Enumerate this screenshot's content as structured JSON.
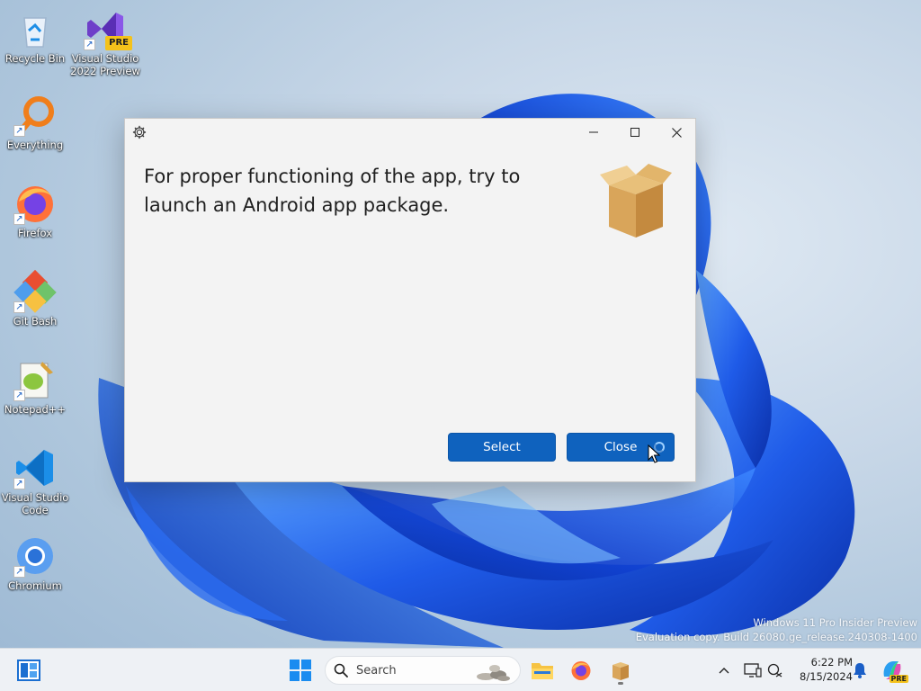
{
  "desktop": {
    "icons": [
      {
        "label": "Recycle Bin",
        "icon": "recycle-bin-icon"
      },
      {
        "label": "Visual Studio 2022 Preview",
        "icon": "visual-studio-preview-icon",
        "badge": "PRE"
      },
      {
        "label": "Everything",
        "icon": "everything-search-icon"
      },
      {
        "label": "Firefox",
        "icon": "firefox-icon"
      },
      {
        "label": "Git Bash",
        "icon": "git-bash-icon"
      },
      {
        "label": "Notepad++",
        "icon": "notepad-plus-plus-icon"
      },
      {
        "label": "Visual Studio Code",
        "icon": "vscode-icon"
      },
      {
        "label": "Chromium",
        "icon": "chromium-icon"
      }
    ],
    "watermark": {
      "line1": "Windows 11 Pro Insider Preview",
      "line2": "Evaluation copy. Build 26080.ge_release.240308-1400"
    }
  },
  "dialog": {
    "message": "For proper functioning of the app, try to launch an Android app package.",
    "select_label": "Select",
    "close_label": "Close",
    "titlebar_icons": [
      "gear-icon",
      "minimize-icon",
      "maximize-icon",
      "close-icon"
    ]
  },
  "taskbar": {
    "search_placeholder": "Search",
    "clock_time": "6:22 PM",
    "clock_date": "8/15/2024",
    "copilot_badge": "PRE"
  },
  "colors": {
    "accent_button": "#0f62be",
    "wallpaper_blue": "#1a56e0",
    "taskbar_bg": "#eef1f5"
  }
}
